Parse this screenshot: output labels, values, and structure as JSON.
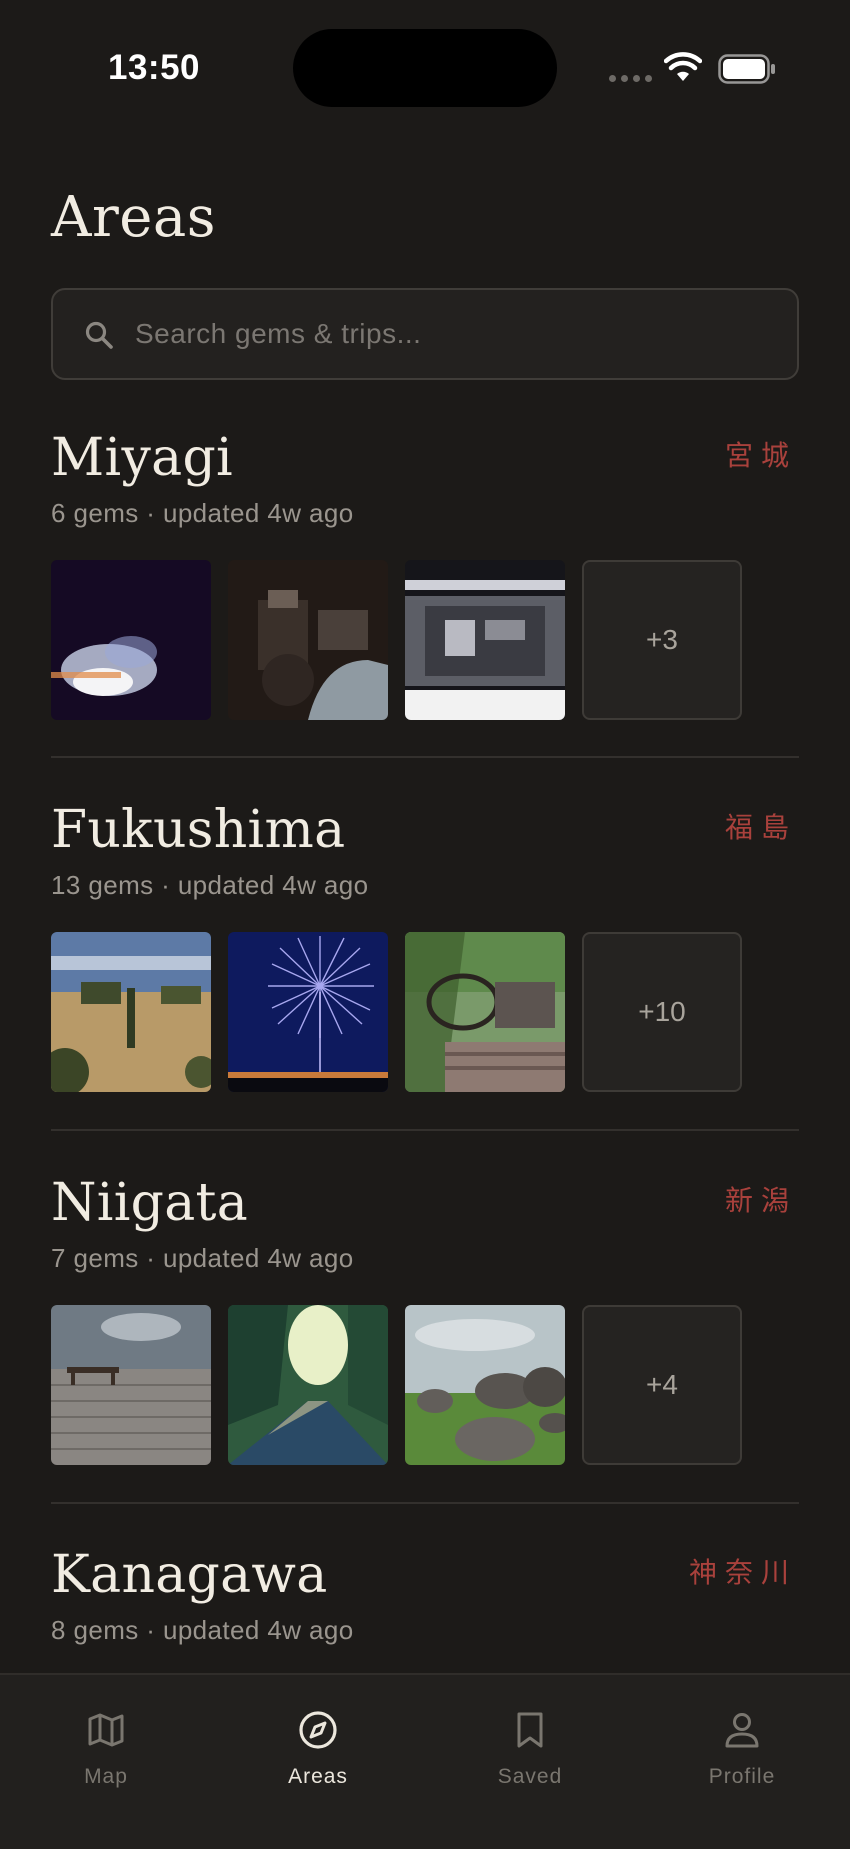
{
  "status_bar": {
    "time": "13:50"
  },
  "page": {
    "title": "Areas"
  },
  "search": {
    "placeholder": "Search gems & trips..."
  },
  "areas": [
    {
      "name": "Miyagi",
      "kanji": "宮城",
      "meta": "6 gems · updated 4w ago",
      "more": "+3"
    },
    {
      "name": "Fukushima",
      "kanji": "福島",
      "meta": "13 gems · updated 4w ago",
      "more": "+10"
    },
    {
      "name": "Niigata",
      "kanji": "新潟",
      "meta": "7 gems · updated 4w ago",
      "more": "+4"
    },
    {
      "name": "Kanagawa",
      "kanji": "神奈川",
      "meta": "8 gems · updated 4w ago"
    }
  ],
  "tabs": [
    {
      "label": "Map",
      "icon": "map-icon"
    },
    {
      "label": "Areas",
      "icon": "compass-icon",
      "active": true
    },
    {
      "label": "Saved",
      "icon": "bookmark-icon"
    },
    {
      "label": "Profile",
      "icon": "person-icon"
    }
  ],
  "colors": {
    "background": "#1c1a18",
    "accent_kanji": "#a9413c",
    "text": "#f1ece2",
    "muted": "#9a958e"
  }
}
